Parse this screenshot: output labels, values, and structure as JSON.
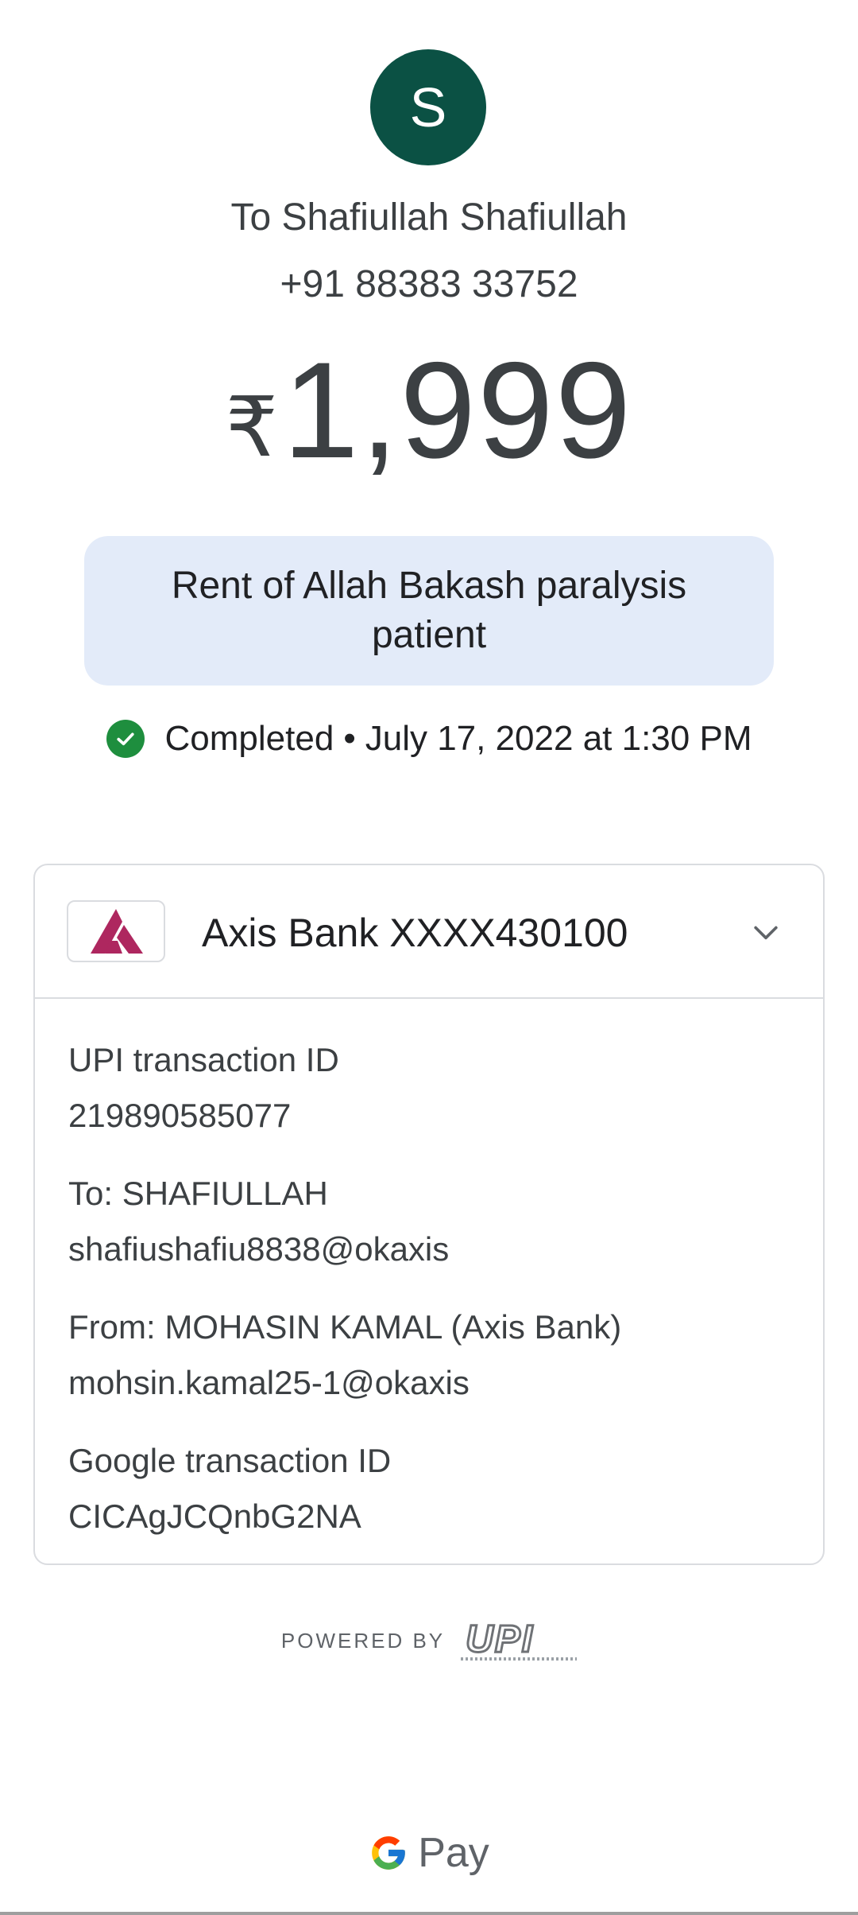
{
  "recipient": {
    "avatar_letter": "S",
    "avatar_color": "#0b5144",
    "name_line": "To Shafiullah Shafiullah",
    "phone": "+91 88383 33752"
  },
  "payment": {
    "currency_symbol": "₹",
    "amount": "1,999",
    "note": "Rent of Allah Bakash paralysis patient",
    "status": "Completed",
    "separator": "•",
    "datetime": "July 17, 2022 at 1:30 PM",
    "status_color": "#1e8e3e"
  },
  "account_card": {
    "bank_label": "Axis Bank XXXX430100",
    "bank_logo_color": "#ae275f",
    "expand_icon": "chevron-down-icon",
    "details": [
      {
        "label": "UPI transaction ID",
        "value": "219890585077"
      },
      {
        "label": "To: SHAFIULLAH",
        "value": "shafiushafiu8838@okaxis"
      },
      {
        "label": "From: MOHASIN KAMAL (Axis Bank)",
        "value": "mohsin.kamal25-1@okaxis"
      },
      {
        "label": "Google transaction ID",
        "value": "CICAgJCQnbG2NA"
      }
    ]
  },
  "footer": {
    "powered_by": "POWERED BY",
    "upi_logo_text": "UPI",
    "brand_pay": "Pay"
  }
}
